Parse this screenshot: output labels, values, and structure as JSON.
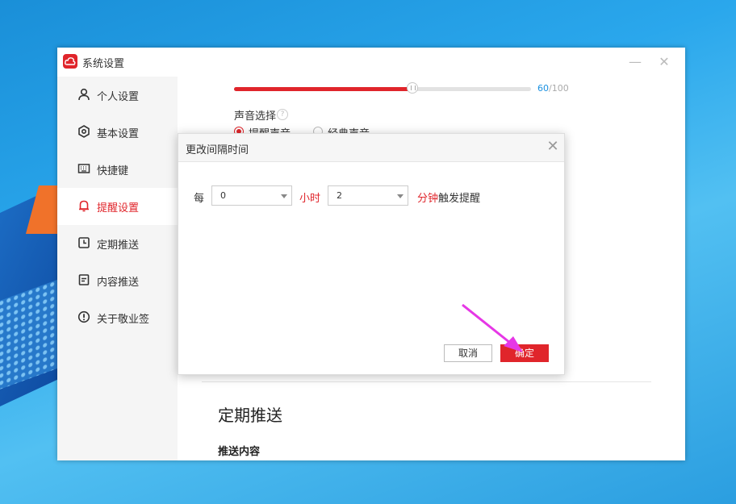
{
  "window": {
    "title": "系统设置",
    "minimize_icon": "minimize-icon",
    "close_icon": "close-icon"
  },
  "sidebar": {
    "items": [
      {
        "label": "个人设置",
        "icon": "user-icon",
        "active": false
      },
      {
        "label": "基本设置",
        "icon": "gear-icon",
        "active": false
      },
      {
        "label": "快捷键",
        "icon": "keyboard-icon",
        "active": false
      },
      {
        "label": "提醒设置",
        "icon": "bell-icon",
        "active": true
      },
      {
        "label": "定期推送",
        "icon": "clock-icon",
        "active": false
      },
      {
        "label": "内容推送",
        "icon": "document-icon",
        "active": false
      },
      {
        "label": "关于敬业签",
        "icon": "info-icon",
        "active": false
      }
    ]
  },
  "content": {
    "volume": {
      "value": "60",
      "max": "/100",
      "fraction": 0.6
    },
    "sound_select_label": "声音选择",
    "sound_options": [
      {
        "label": "提醒声音",
        "checked": true
      },
      {
        "label": "经典声音",
        "checked": false
      }
    ],
    "section_title": "定期推送",
    "section_sub": "推送内容"
  },
  "dialog": {
    "title": "更改间隔时间",
    "each_label": "每",
    "hour_value": "0",
    "hour_label": "小时",
    "minute_value": "2",
    "minute_label": "分钟",
    "trigger_label": "触发提醒",
    "cancel_label": "取消",
    "ok_label": "确定"
  },
  "colors": {
    "accent": "#e0252b",
    "link_blue": "#1a90e0",
    "annotation_arrow": "#e637e6"
  }
}
